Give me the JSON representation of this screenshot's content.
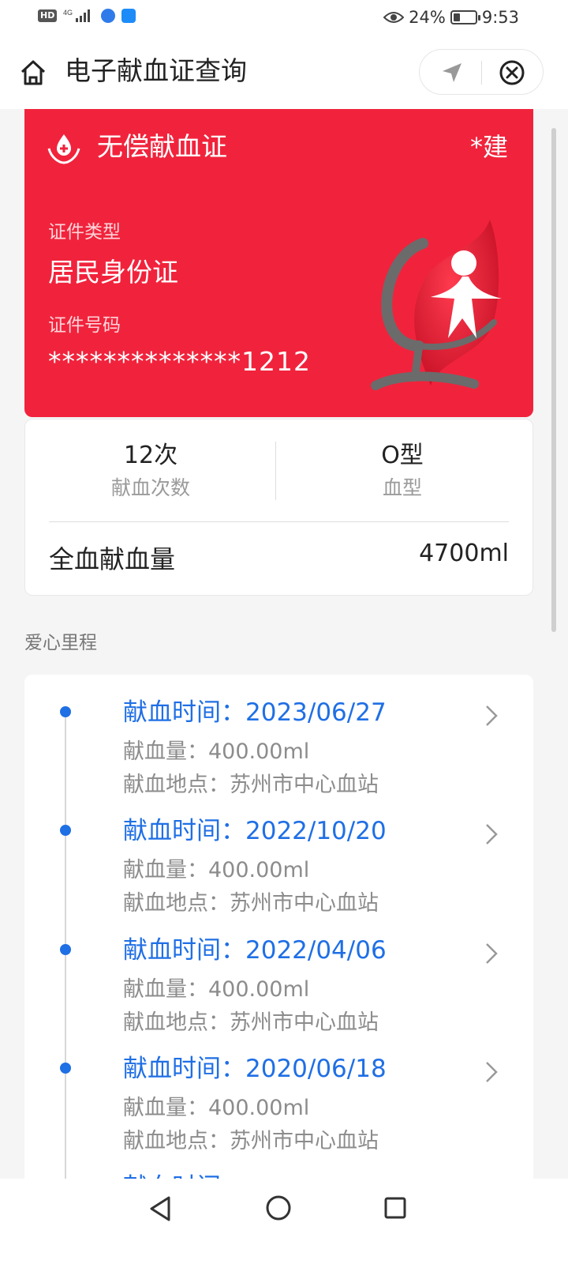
{
  "status_bar": {
    "network": "4G",
    "hd": "HD",
    "battery": "24%",
    "time": "9:53"
  },
  "header": {
    "title": "电子献血证查询"
  },
  "card": {
    "title": "无偿献血证",
    "name": "*建",
    "id_type_label": "证件类型",
    "id_type_value": "居民身份证",
    "id_no_label": "证件号码",
    "id_no_value": "**************1212"
  },
  "stats": {
    "count_value": "12次",
    "count_label": "献血次数",
    "blood_type_value": "O型",
    "blood_type_label": "血型",
    "total_label": "全血献血量",
    "total_value": "4700ml"
  },
  "section": {
    "title": "爱心里程"
  },
  "timeline": [
    {
      "date": "献血时间：2023/06/27",
      "amount": "献血量：400.00ml",
      "location": "献血地点：苏州市中心血站"
    },
    {
      "date": "献血时间：2022/10/20",
      "amount": "献血量：400.00ml",
      "location": "献血地点：苏州市中心血站"
    },
    {
      "date": "献血时间：2022/04/06",
      "amount": "献血量：400.00ml",
      "location": "献血地点：苏州市中心血站"
    },
    {
      "date": "献血时间：2020/06/18",
      "amount": "献血量：400.00ml",
      "location": "献血地点：苏州市中心血站"
    },
    {
      "date": "献血时间",
      "amount": "",
      "location": ""
    }
  ],
  "colors": {
    "card_red": "#f1233c",
    "accent_blue": "#1f6fe5"
  },
  "icons": {
    "home": "home-icon",
    "navigation": "navigation-arrow-icon",
    "close": "close-circle-icon",
    "chevron": "chevron-right-icon"
  }
}
